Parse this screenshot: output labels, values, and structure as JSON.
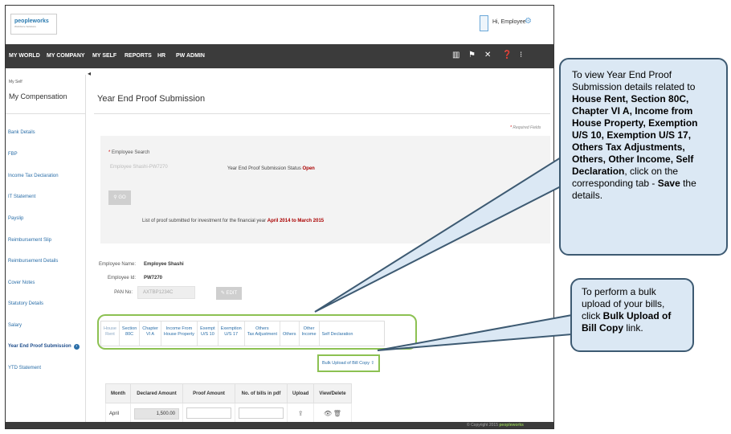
{
  "header": {
    "logo_text": "peopleworks",
    "logo_subtext": "Workforce Solutions",
    "greeting": "Hi, Employee"
  },
  "nav": {
    "items": [
      "MY WORLD",
      "MY COMPANY",
      "MY SELF",
      "REPORTS",
      "HR",
      "PW ADMIN"
    ],
    "icons": [
      "book-icon",
      "pin-icon",
      "tools-icon",
      "help-icon",
      "share-icon"
    ]
  },
  "sidebar": {
    "section": "My Self",
    "title": "My Compensation",
    "items": [
      "Bank Details",
      "FBP",
      "Income Tax Declaration",
      "IT Statement",
      "Payslip",
      "Reimbursement Slip",
      "Reimbursement Details",
      "Cover Notes",
      "Statutory Details",
      "Salary",
      "Year End Proof Submission",
      "YTD Statement"
    ],
    "active_index": 10
  },
  "main": {
    "page_title": "Year End Proof Submission",
    "required_note": "Required Fields",
    "search": {
      "label": "Employee Search",
      "value": "Employee Shashi-PW7270",
      "status_label": "Year End Proof Submission Status",
      "status_value": "Open",
      "go_label": "GO",
      "fy_label": "List of proof submitted for investment for the financial year",
      "fy_value": "April 2014 to March 2015"
    },
    "employee": {
      "name_label": "Employee Name:",
      "name_value": "Employee Shashi",
      "id_label": "Employee Id:",
      "id_value": "PW7270",
      "pan_label": "PAN No:",
      "pan_value": "AXTBP1234C",
      "edit_label": "EDIT"
    },
    "tabs": [
      "House\nRent",
      "Section\n80C",
      "Chapter\nVI A",
      "Income From\nHouse Property",
      "Exempt\nU/S 10",
      "Exemption\nU/S 17",
      "Others\nTax Adjustment",
      "Others",
      "Other\nIncome",
      "Self Declaration"
    ],
    "bulk_upload_label": "Bulk Upload of Bill Copy",
    "table": {
      "headers": [
        "Month",
        "Declared Amount",
        "Proof Amount",
        "No. of bills in pdf",
        "Upload",
        "View/Delete"
      ],
      "rows": [
        {
          "month": "April",
          "declared": "1,500.00",
          "proof": "",
          "bills": ""
        }
      ]
    }
  },
  "footer": {
    "copyright": "© Copyright 2015",
    "brand": "peopleworks"
  },
  "callouts": {
    "first": {
      "t1": "To view Year End Proof Submission details related to ",
      "b1": "House Rent, Section 80C, Chapter VI A, Income from House Property, Exemption U/S 10, Exemption U/S 17, Others Tax Adjustments, Others, Other Income, Self Declaration",
      "t2": ", click on the corresponding tab - ",
      "b2": "Save",
      "t3": " the details."
    },
    "second": {
      "t1": "To perform a bulk upload of your bills, click ",
      "b1": "Bulk Upload of Bill Copy",
      "t2": " link."
    }
  },
  "colors": {
    "nav_bg": "#3b3b3b",
    "link": "#2a6ea8",
    "highlight": "#8cc152",
    "callout_bg": "#dbe8f4",
    "callout_border": "#3d5a72",
    "status": "#aa0000"
  }
}
